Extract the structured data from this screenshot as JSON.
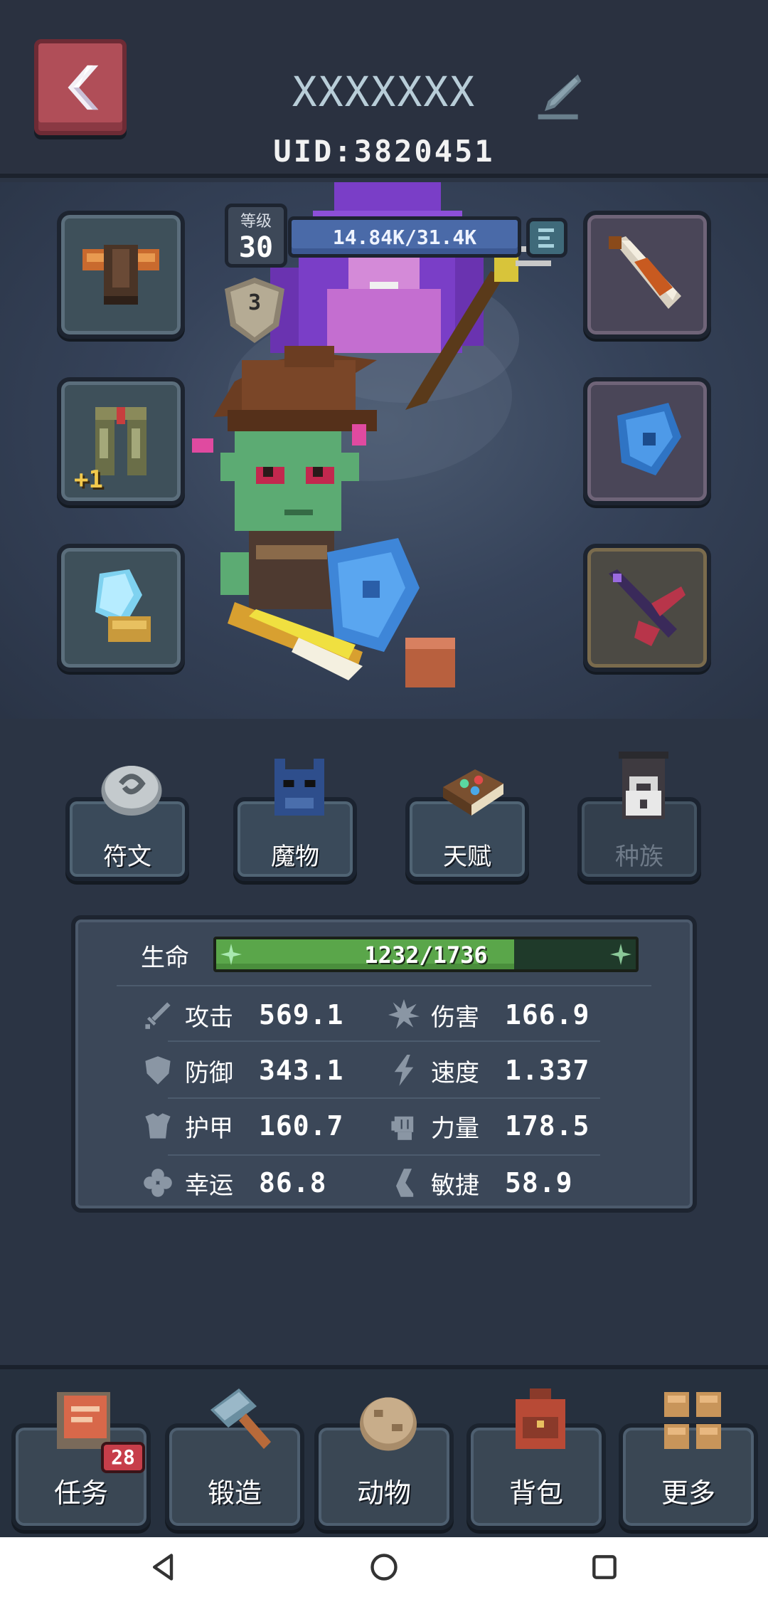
{
  "header": {
    "player_name": "XXXXXXX",
    "uid": "UID:3820451"
  },
  "hero": {
    "level_label": "等级",
    "level": "30",
    "exp_text": "14.84K/31.4K",
    "exp_fraction": 0.473,
    "rank": "3",
    "equipment": {
      "left": [
        "chest-armor",
        "leg-armor",
        "crystal-gauntlet"
      ],
      "right": [
        "flame-sword",
        "blue-rune-shield",
        "dark-crossbow"
      ],
      "leg_armor_bonus": "+1"
    }
  },
  "menu": [
    {
      "label": "符文",
      "icon": "rune-stone-icon",
      "locked": false
    },
    {
      "label": "魔物",
      "icon": "monster-icon",
      "locked": false
    },
    {
      "label": "天赋",
      "icon": "talent-book-icon",
      "locked": false
    },
    {
      "label": "种族",
      "icon": "lock-icon",
      "locked": true
    }
  ],
  "stats": {
    "hp_label": "生命",
    "hp_text": "1232/1736",
    "hp_fraction": 0.71,
    "rows": [
      {
        "left": {
          "icon": "sword-icon",
          "label": "攻击",
          "value": "569.1"
        },
        "right": {
          "icon": "burst-icon",
          "label": "伤害",
          "value": "166.9"
        }
      },
      {
        "left": {
          "icon": "shield-icon",
          "label": "防御",
          "value": "343.1"
        },
        "right": {
          "icon": "lightning-icon",
          "label": "速度",
          "value": "1.337"
        }
      },
      {
        "left": {
          "icon": "armor-icon",
          "label": "护甲",
          "value": "160.7"
        },
        "right": {
          "icon": "fist-icon",
          "label": "力量",
          "value": "178.5"
        }
      },
      {
        "left": {
          "icon": "clover-icon",
          "label": "幸运",
          "value": "86.8"
        },
        "right": {
          "icon": "boot-icon",
          "label": "敏捷",
          "value": "58.9"
        }
      }
    ]
  },
  "bottom_nav": [
    {
      "label": "任务",
      "icon": "quest-board-icon",
      "badge": "28"
    },
    {
      "label": "锻造",
      "icon": "hammer-icon"
    },
    {
      "label": "动物",
      "icon": "egg-icon"
    },
    {
      "label": "背包",
      "icon": "backpack-icon"
    },
    {
      "label": "更多",
      "icon": "grid-more-icon"
    }
  ],
  "colors": {
    "background": "#2b3444",
    "back_button": "#b04e58",
    "exp_bar": "#4a6aa8",
    "hp_bar": "#5aa64a"
  }
}
